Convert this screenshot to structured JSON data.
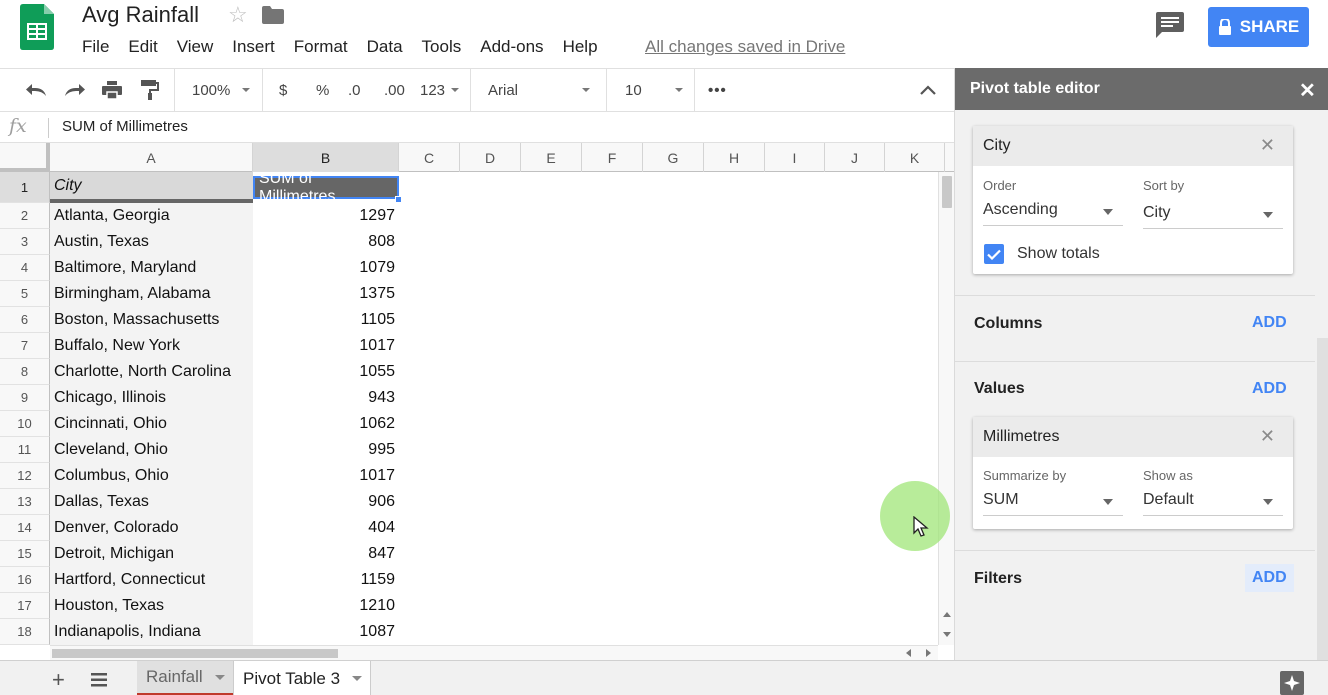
{
  "app": {
    "title": "Avg Rainfall",
    "menu": [
      "File",
      "Edit",
      "View",
      "Insert",
      "Format",
      "Data",
      "Tools",
      "Add-ons",
      "Help"
    ],
    "saved_status": "All changes saved in Drive",
    "share_label": "SHARE"
  },
  "toolbar": {
    "zoom": "100%",
    "currency": "$",
    "percent": "%",
    "dec_decrease": ".0",
    "dec_increase": ".00",
    "more_formats": "123",
    "font": "Arial",
    "font_size": "10",
    "more": "•••"
  },
  "formula_bar": {
    "fx": "fx",
    "content": "SUM of Millimetres"
  },
  "columns": [
    "A",
    "B",
    "C",
    "D",
    "E",
    "F",
    "G",
    "H",
    "I",
    "J",
    "K"
  ],
  "rows": [
    {
      "num": "1",
      "a": "City",
      "b": "SUM of Millimetres"
    },
    {
      "num": "2",
      "a": "Atlanta, Georgia",
      "b": "1297"
    },
    {
      "num": "3",
      "a": "Austin, Texas",
      "b": "808"
    },
    {
      "num": "4",
      "a": "Baltimore, Maryland",
      "b": "1079"
    },
    {
      "num": "5",
      "a": "Birmingham, Alabama",
      "b": "1375"
    },
    {
      "num": "6",
      "a": "Boston, Massachusetts",
      "b": "1105"
    },
    {
      "num": "7",
      "a": "Buffalo, New York",
      "b": "1017"
    },
    {
      "num": "8",
      "a": "Charlotte, North Carolina",
      "b": "1055"
    },
    {
      "num": "9",
      "a": "Chicago, Illinois",
      "b": "943"
    },
    {
      "num": "10",
      "a": "Cincinnati, Ohio",
      "b": "1062"
    },
    {
      "num": "11",
      "a": "Cleveland, Ohio",
      "b": "995"
    },
    {
      "num": "12",
      "a": "Columbus, Ohio",
      "b": "1017"
    },
    {
      "num": "13",
      "a": "Dallas, Texas",
      "b": "906"
    },
    {
      "num": "14",
      "a": "Denver, Colorado",
      "b": "404"
    },
    {
      "num": "15",
      "a": "Detroit, Michigan",
      "b": "847"
    },
    {
      "num": "16",
      "a": "Hartford, Connecticut",
      "b": "1159"
    },
    {
      "num": "17",
      "a": "Houston, Texas",
      "b": "1210"
    },
    {
      "num": "18",
      "a": "Indianapolis, Indiana",
      "b": "1087"
    }
  ],
  "pivot": {
    "title": "Pivot table editor",
    "rows_card": {
      "field": "City",
      "order_label": "Order",
      "order_value": "Ascending",
      "sort_label": "Sort by",
      "sort_value": "City",
      "show_totals": "Show totals"
    },
    "columns_label": "Columns",
    "values_label": "Values",
    "values_card": {
      "field": "Millimetres",
      "summarize_label": "Summarize by",
      "summarize_value": "SUM",
      "show_as_label": "Show as",
      "show_as_value": "Default"
    },
    "filters_label": "Filters",
    "add_label": "ADD"
  },
  "sheets": [
    {
      "name": "Rainfall"
    },
    {
      "name": "Pivot Table 3"
    }
  ],
  "colors": {
    "accent": "#4285f4",
    "sheets_green": "#0f9d58",
    "panel_header": "#6b6b6b"
  }
}
